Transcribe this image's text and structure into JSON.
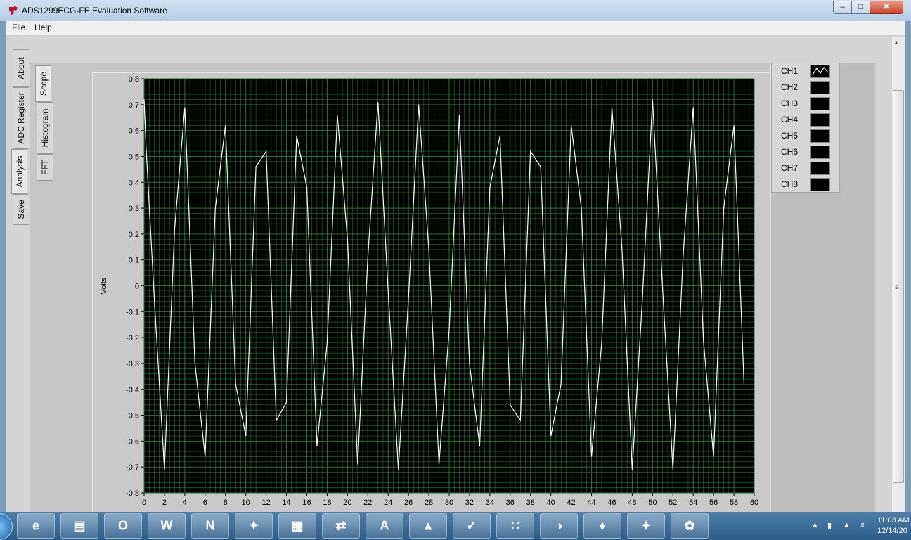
{
  "window": {
    "title": "ADS1299ECG-FE Evaluation Software",
    "min_label": "–",
    "max_label": "□",
    "close_label": "✕"
  },
  "menu": {
    "file": "File",
    "help": "Help"
  },
  "main_tabs": [
    {
      "label": "About"
    },
    {
      "label": "ADC Register"
    },
    {
      "label": "Analysis",
      "active": true
    },
    {
      "label": "Save"
    }
  ],
  "sub_tabs": [
    {
      "label": "Scope",
      "active": true
    },
    {
      "label": "Histogram"
    },
    {
      "label": "FFT"
    }
  ],
  "legend": [
    {
      "label": "CH1",
      "active": true
    },
    {
      "label": "CH2"
    },
    {
      "label": "CH3"
    },
    {
      "label": "CH4"
    },
    {
      "label": "CH5"
    },
    {
      "label": "CH6"
    },
    {
      "label": "CH7"
    },
    {
      "label": "CH8"
    }
  ],
  "chart_data": {
    "type": "line",
    "ylabel": "Volts",
    "xlabel": "",
    "xlim": [
      0,
      60
    ],
    "ylim": [
      -0.8,
      0.8
    ],
    "x_ticks": [
      0,
      2,
      4,
      6,
      8,
      10,
      12,
      14,
      16,
      18,
      20,
      22,
      24,
      26,
      28,
      30,
      32,
      34,
      36,
      38,
      40,
      42,
      44,
      46,
      48,
      50,
      52,
      54,
      56,
      58,
      60
    ],
    "y_ticks": [
      0.8,
      0.7,
      0.6,
      0.5,
      0.4,
      0.3,
      0.2,
      0.1,
      0,
      -0.1,
      -0.2,
      -0.3,
      -0.4,
      -0.5,
      -0.6,
      -0.7,
      -0.8
    ],
    "grid": true,
    "colors": {
      "background": "#000000",
      "grid": "#1f7a2a",
      "trace": "#ffffff"
    },
    "series": [
      {
        "name": "CH1",
        "x": [
          0,
          0.2,
          1,
          2,
          3,
          4,
          5,
          6,
          7,
          8,
          9,
          10,
          11,
          12,
          13,
          14,
          15,
          16,
          17,
          18,
          19,
          20,
          21,
          22,
          23,
          24,
          25,
          26,
          27,
          28,
          29,
          30,
          31,
          32,
          33,
          34,
          35,
          36,
          37,
          38,
          39,
          40,
          41,
          42,
          43,
          44,
          45,
          46,
          47,
          48,
          49,
          50,
          51,
          52,
          53,
          54,
          55,
          56,
          57,
          58,
          59
        ],
        "y": [
          0.72,
          0.53,
          -0.05,
          -0.71,
          0.22,
          0.69,
          -0.3,
          -0.66,
          0.3,
          0.62,
          -0.38,
          -0.58,
          0.46,
          0.52,
          -0.52,
          -0.45,
          0.58,
          0.38,
          -0.62,
          -0.22,
          0.66,
          0.18,
          -0.69,
          0.11,
          0.71,
          -0.02,
          -0.71,
          -0.05,
          0.7,
          0.14,
          -0.69,
          -0.17,
          0.66,
          -0.3,
          -0.62,
          0.38,
          0.58,
          -0.46,
          -0.52,
          0.52,
          0.46,
          -0.58,
          -0.38,
          0.62,
          0.3,
          -0.66,
          -0.22,
          0.69,
          0.14,
          -0.71,
          -0.05,
          0.72,
          -0.02,
          -0.71,
          0.11,
          0.69,
          -0.21,
          -0.66,
          0.3,
          0.62,
          -0.38
        ]
      }
    ]
  },
  "taskbar": {
    "apps": [
      {
        "icon": "e"
      },
      {
        "icon": "▤"
      },
      {
        "icon": "O"
      },
      {
        "icon": "W"
      },
      {
        "icon": "N"
      },
      {
        "icon": "✦"
      },
      {
        "icon": "▦"
      },
      {
        "icon": "⇄"
      },
      {
        "icon": "A"
      },
      {
        "icon": "▲"
      },
      {
        "icon": "✓"
      },
      {
        "icon": "∷"
      },
      {
        "icon": "◑"
      },
      {
        "icon": "♦"
      },
      {
        "icon": "✦"
      },
      {
        "icon": "✿"
      }
    ],
    "clock_time": "11:03 AM",
    "clock_date": "12/14/20"
  }
}
